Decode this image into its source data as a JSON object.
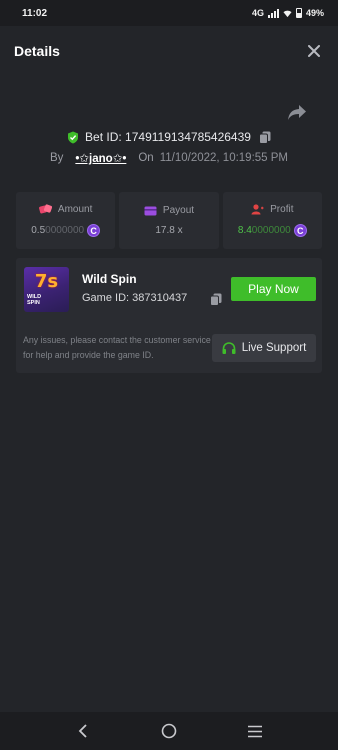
{
  "status_bar": {
    "time": "11:02",
    "network": "4G",
    "battery": "49%"
  },
  "header": {
    "title": "Details"
  },
  "bet": {
    "bet_id_label": "Bet ID: 1749119134785426439",
    "by_label": "By",
    "username": "•✩jano✩•",
    "on_label": "On",
    "datetime": "11/10/2022, 10:19:55 PM"
  },
  "stats": [
    {
      "label": "Amount",
      "value_main": "0.5",
      "value_dim": "0000000",
      "icon": "dice-icon",
      "color": "#e8456b"
    },
    {
      "label": "Payout",
      "value_main": "17.8 x",
      "value_dim": "",
      "icon": "wallet-icon",
      "color": "#9b4de0"
    },
    {
      "label": "Profit",
      "value_main": "8.4",
      "value_dim": "0000000",
      "icon": "profit-user-icon",
      "color": "#e04444"
    }
  ],
  "coin_symbol": "C",
  "game": {
    "name": "Wild Spin",
    "game_id_label": "Game ID: 387310437",
    "thumb_sevens": "7s",
    "thumb_label_1": "WILD",
    "thumb_label_2": "SPIN",
    "play_label": "Play Now",
    "issue_text": "Any issues, please contact the customer service for help and provide the game ID.",
    "support_label": "Live Support"
  },
  "colors": {
    "accent_green": "#3fbd2a",
    "profit_green": "#4fc24a",
    "coin_purple": "#7a3fd6",
    "background": "#232529",
    "card": "#2a2c31"
  }
}
